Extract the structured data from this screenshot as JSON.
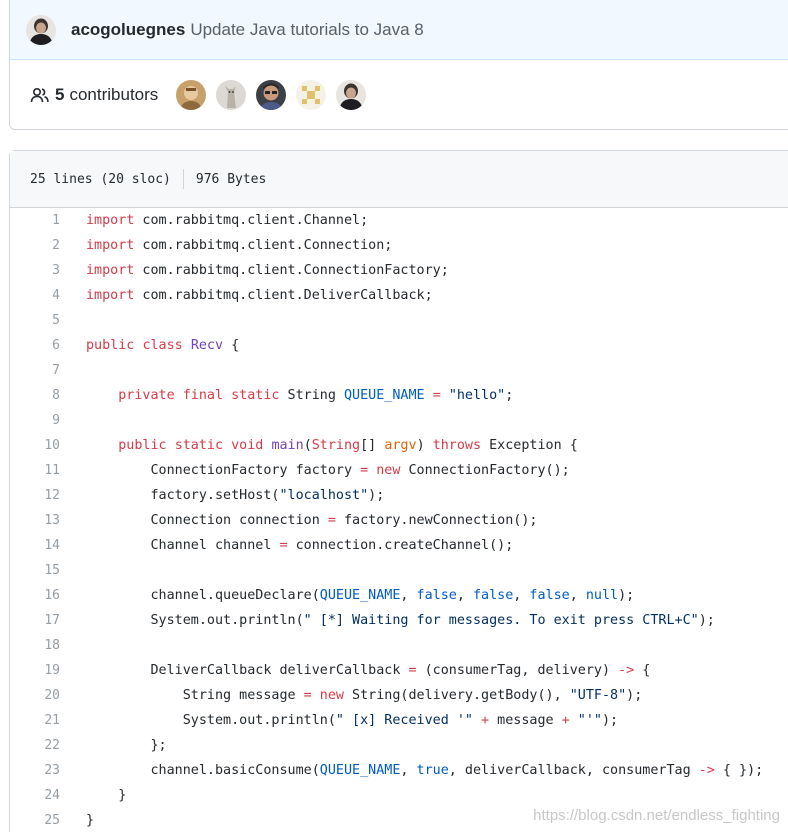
{
  "commit": {
    "author": "acogoluegnes",
    "message": "Update Java tutorials to Java 8"
  },
  "contributors": {
    "count": "5",
    "label": "contributors",
    "icon": "people-icon",
    "avatars": [
      "avatar-1",
      "avatar-2",
      "avatar-3",
      "avatar-4",
      "avatar-5"
    ]
  },
  "file": {
    "lines_info": "25 lines (20 sloc)",
    "size": "976 Bytes"
  },
  "code": [
    {
      "n": "1",
      "t": "import com.rabbitmq.client.Channel;"
    },
    {
      "n": "2",
      "t": "import com.rabbitmq.client.Connection;"
    },
    {
      "n": "3",
      "t": "import com.rabbitmq.client.ConnectionFactory;"
    },
    {
      "n": "4",
      "t": "import com.rabbitmq.client.DeliverCallback;"
    },
    {
      "n": "5",
      "t": ""
    },
    {
      "n": "6",
      "t": "public class Recv {"
    },
    {
      "n": "7",
      "t": ""
    },
    {
      "n": "8",
      "t": "    private final static String QUEUE_NAME = \"hello\";"
    },
    {
      "n": "9",
      "t": ""
    },
    {
      "n": "10",
      "t": "    public static void main(String[] argv) throws Exception {"
    },
    {
      "n": "11",
      "t": "        ConnectionFactory factory = new ConnectionFactory();"
    },
    {
      "n": "12",
      "t": "        factory.setHost(\"localhost\");"
    },
    {
      "n": "13",
      "t": "        Connection connection = factory.newConnection();"
    },
    {
      "n": "14",
      "t": "        Channel channel = connection.createChannel();"
    },
    {
      "n": "15",
      "t": ""
    },
    {
      "n": "16",
      "t": "        channel.queueDeclare(QUEUE_NAME, false, false, false, null);"
    },
    {
      "n": "17",
      "t": "        System.out.println(\" [*] Waiting for messages. To exit press CTRL+C\");"
    },
    {
      "n": "18",
      "t": ""
    },
    {
      "n": "19",
      "t": "        DeliverCallback deliverCallback = (consumerTag, delivery) -> {"
    },
    {
      "n": "20",
      "t": "            String message = new String(delivery.getBody(), \"UTF-8\");"
    },
    {
      "n": "21",
      "t": "            System.out.println(\" [x] Received '\" + message + \"'\");"
    },
    {
      "n": "22",
      "t": "        };"
    },
    {
      "n": "23",
      "t": "        channel.basicConsume(QUEUE_NAME, true, deliverCallback, consumerTag -> { });"
    },
    {
      "n": "24",
      "t": "    }"
    },
    {
      "n": "25",
      "t": "}"
    }
  ],
  "watermark": "https://blog.csdn.net/endless_fighting"
}
